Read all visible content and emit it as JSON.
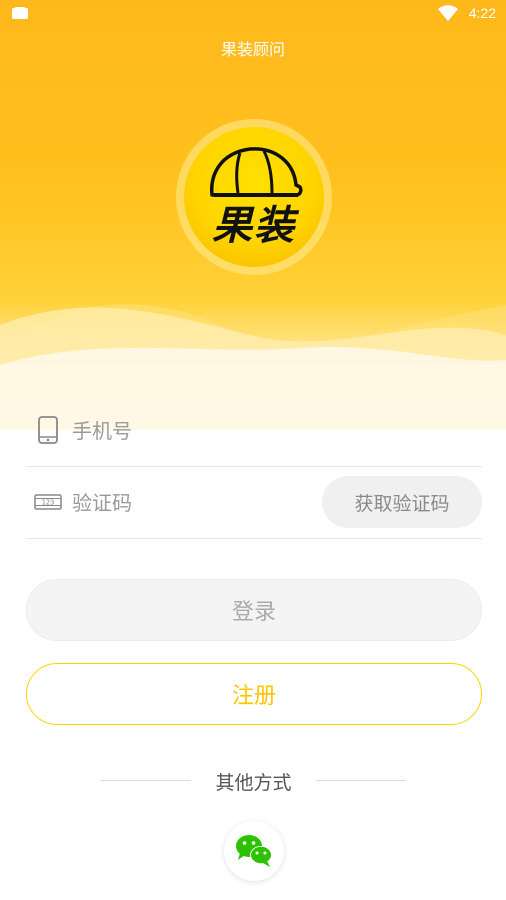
{
  "status_bar": {
    "time": "4:22"
  },
  "app": {
    "title": "果装顾问",
    "logo_text": "果装"
  },
  "form": {
    "phone_placeholder": "手机号",
    "code_placeholder": "验证码",
    "get_code_label": "获取验证码"
  },
  "actions": {
    "login_label": "登录",
    "register_label": "注册"
  },
  "other": {
    "label": "其他方式"
  },
  "icons": {
    "phone": "phone-icon",
    "code": "keypad-icon",
    "wechat": "wechat-icon"
  },
  "colors": {
    "brand_yellow": "#ffc21f",
    "register_border": "#ffd200",
    "register_text": "#ffc400",
    "wechat_green": "#2dc100"
  }
}
